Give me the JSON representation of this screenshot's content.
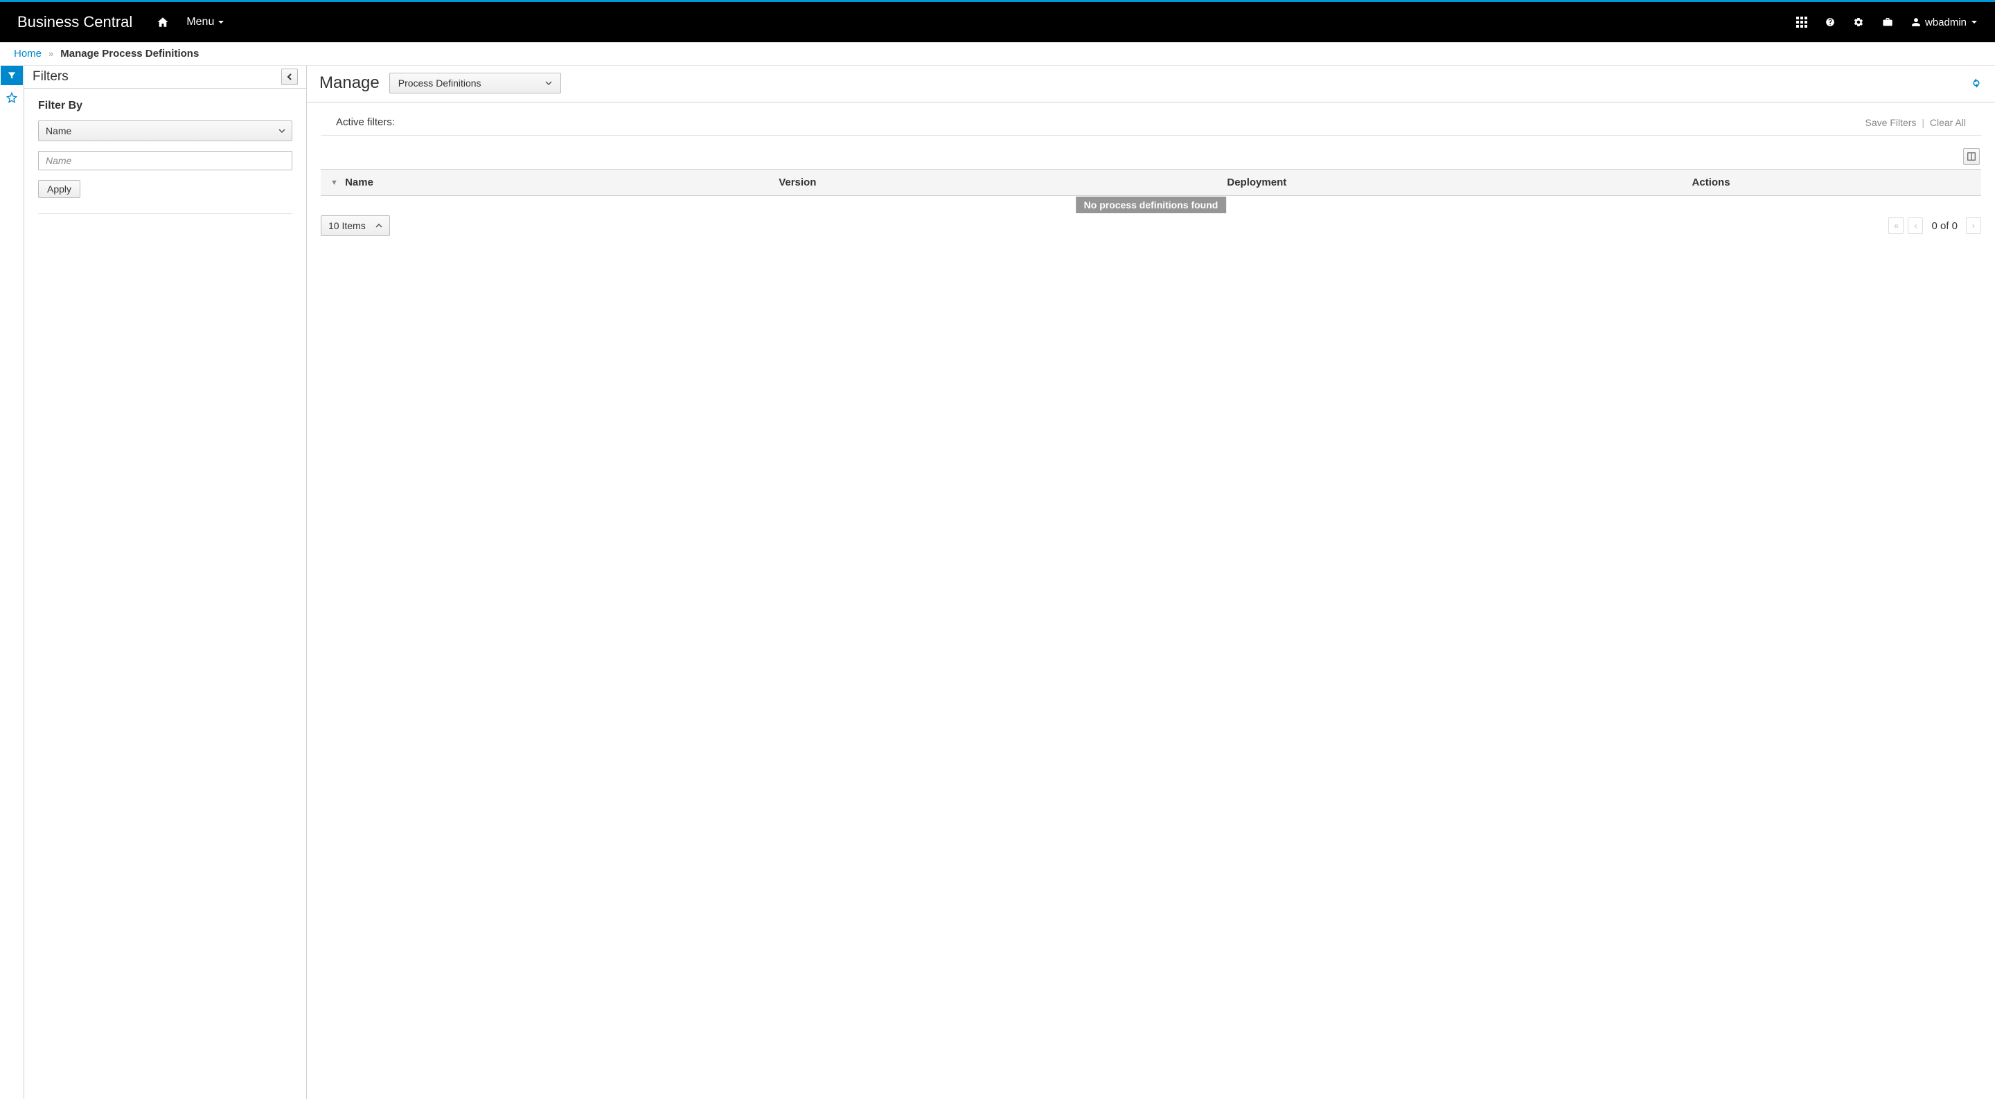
{
  "topnav": {
    "brand": "Business Central",
    "menu_label": "Menu",
    "user_name": "wbadmin"
  },
  "breadcrumb": {
    "home": "Home",
    "current": "Manage Process Definitions"
  },
  "filters_panel": {
    "title": "Filters",
    "filter_by_label": "Filter By",
    "select_value": "Name",
    "input_placeholder": "Name",
    "apply_label": "Apply"
  },
  "main": {
    "title": "Manage",
    "type_value": "Process Definitions",
    "active_filters_label": "Active filters:",
    "save_filters": "Save Filters",
    "clear_all": "Clear All"
  },
  "table": {
    "columns": {
      "name": "Name",
      "version": "Version",
      "deployment": "Deployment",
      "actions": "Actions"
    },
    "empty_message": "No process definitions found"
  },
  "pager": {
    "items_label": "10 Items",
    "status": "0 of 0"
  }
}
